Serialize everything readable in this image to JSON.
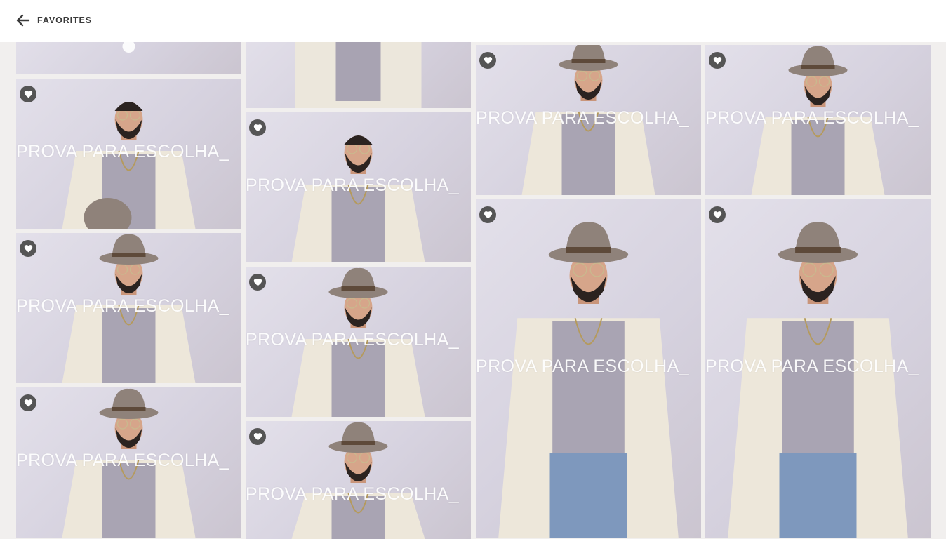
{
  "header": {
    "title": "FAVORITES",
    "back_icon": "arrow-left-icon"
  },
  "gallery": {
    "watermark_text": "PROVA PARA ESCOLHA_",
    "favorite_icon": "heart-icon",
    "photos": [
      {
        "id": "c1-top",
        "watermark": ""
      },
      {
        "id": "c1-p2",
        "watermark": "PROVA PARA ESCOLHA_"
      },
      {
        "id": "c1-p3",
        "watermark": "PROVA PARA ESCOLHA_"
      },
      {
        "id": "c1-p4",
        "watermark": "PROVA PARA ESCOLHA_"
      },
      {
        "id": "c2-top",
        "watermark": ""
      },
      {
        "id": "c2-p2",
        "watermark": "PROVA PARA ESCOLHA_"
      },
      {
        "id": "c2-p3",
        "watermark": "PROVA PARA ESCOLHA_"
      },
      {
        "id": "c2-p4",
        "watermark": "PROVA PARA ESCOLHA_"
      },
      {
        "id": "c3-p1",
        "watermark": "PROVA PARA ESCOLHA_"
      },
      {
        "id": "c3-p2",
        "watermark": "PROVA PARA ESCOLHA_"
      },
      {
        "id": "c4-p1",
        "watermark": "PROVA PARA ESCOLHA_"
      },
      {
        "id": "c4-p2",
        "watermark": "PROVA PARA ESCOLHA_"
      }
    ]
  },
  "colors": {
    "header_bg": "#ffffff",
    "page_bg": "#f1efee",
    "favorite_badge": "#555555",
    "watermark": "#ffffff"
  }
}
